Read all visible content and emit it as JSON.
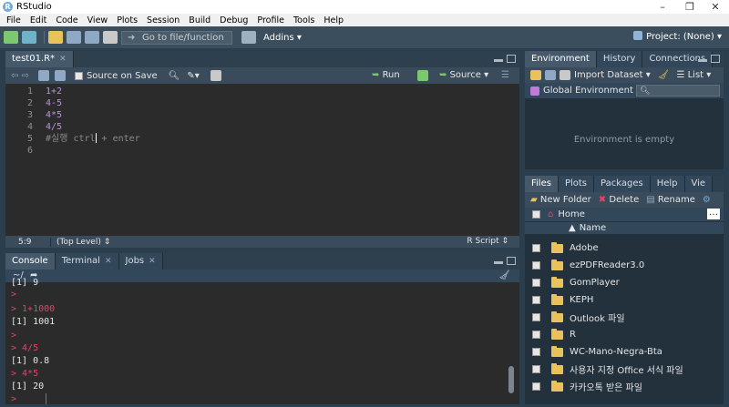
{
  "window": {
    "title": "RStudio"
  },
  "menu": [
    "File",
    "Edit",
    "Code",
    "View",
    "Plots",
    "Session",
    "Build",
    "Debug",
    "Profile",
    "Tools",
    "Help"
  ],
  "toolbar": {
    "goto_placeholder": "Go to file/function",
    "addins": "Addins",
    "project": "Project: (None)"
  },
  "editor": {
    "tab": "test01.R*",
    "source_on_save": "Source on Save",
    "run": "Run",
    "source": "Source",
    "lines": [
      {
        "num": "1",
        "text": "1+2"
      },
      {
        "num": "2",
        "text": "4-5"
      },
      {
        "num": "3",
        "text": "4*5"
      },
      {
        "num": "4",
        "text": "4/5"
      },
      {
        "num": "5",
        "text_a": "#실행 ctrl",
        "text_b": " + enter"
      },
      {
        "num": "6",
        "text": ""
      }
    ],
    "status": {
      "position": "5:9",
      "scope": "(Top Level)",
      "filetype": "R Script"
    }
  },
  "console": {
    "tabs": [
      "Console",
      "Terminal",
      "Jobs"
    ],
    "path": "~/",
    "lines": [
      {
        "type": "out",
        "text": "[1] 9"
      },
      {
        "type": "prompt",
        "text": ">"
      },
      {
        "type": "prompt",
        "text": "> 1+1000"
      },
      {
        "type": "out",
        "text": "[1] 1001"
      },
      {
        "type": "prompt",
        "text": ">"
      },
      {
        "type": "prompt",
        "text": "> 4/5"
      },
      {
        "type": "out",
        "text": "[1] 0.8"
      },
      {
        "type": "prompt",
        "text": "> 4*5"
      },
      {
        "type": "out",
        "text": "[1] 20"
      },
      {
        "type": "prompt",
        "text": ">"
      }
    ]
  },
  "environment": {
    "tabs": [
      "Environment",
      "History",
      "Connections"
    ],
    "import_dataset": "Import Dataset",
    "list": "List",
    "global_env": "Global Environment",
    "empty": "Environment is empty"
  },
  "files": {
    "tabs": [
      "Files",
      "Plots",
      "Packages",
      "Help",
      "Vie"
    ],
    "new_folder": "New Folder",
    "delete": "Delete",
    "rename": "Rename",
    "home": "Home",
    "name_col": "Name",
    "items": [
      "Adobe",
      "ezPDFReader3.0",
      "GomPlayer",
      "KEPH",
      "Outlook 파일",
      "R",
      "WC-Mano-Negra-Bta",
      "사용자 지정 Office 서식 파일",
      "카카오톡 받은 파일"
    ]
  },
  "colors": {
    "accent": "#75aadb",
    "prompt": "#e0446a",
    "code": "#b894d9",
    "folder": "#e9c35a"
  }
}
